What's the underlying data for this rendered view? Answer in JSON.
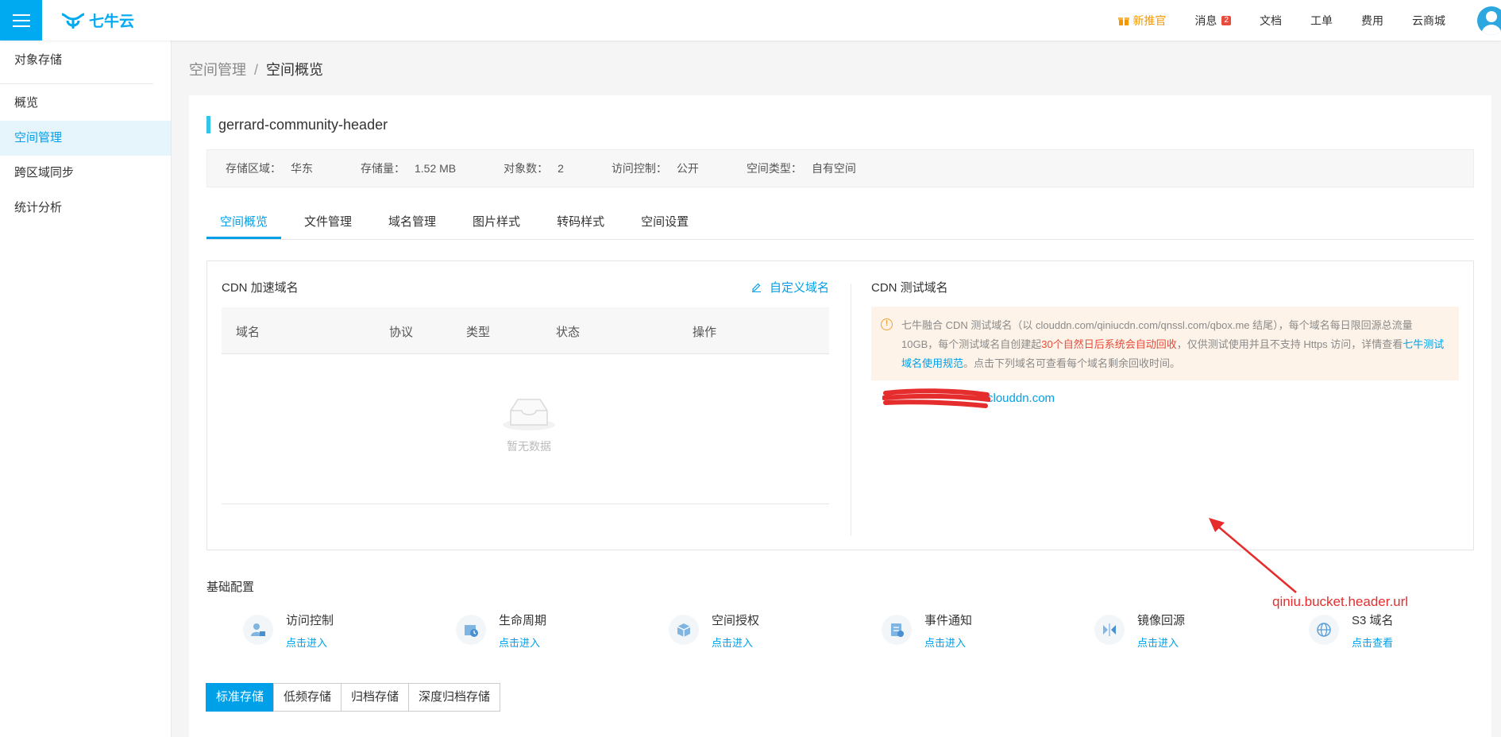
{
  "app": {
    "logo_text": "七牛云"
  },
  "topnav": {
    "promo": "新推官",
    "messages": "消息",
    "messages_count": "2",
    "docs": "文档",
    "tickets": "工单",
    "billing": "费用",
    "market": "云商城"
  },
  "sidebar": {
    "title": "对象存储",
    "items": [
      {
        "label": "概览"
      },
      {
        "label": "空间管理",
        "active": true
      },
      {
        "label": "跨区域同步"
      },
      {
        "label": "统计分析"
      }
    ]
  },
  "breadcrumb": {
    "parent": "空间管理",
    "separator": "/",
    "current": "空间概览"
  },
  "bucket": {
    "name": "gerrard-community-header",
    "region_label": "存储区域：",
    "region": "华东",
    "size_label": "存储量：",
    "size": "1.52 MB",
    "objects_label": "对象数：",
    "objects": "2",
    "access_label": "访问控制：",
    "access": "公开",
    "type_label": "空间类型：",
    "type": "自有空间"
  },
  "tabs": [
    "空间概览",
    "文件管理",
    "域名管理",
    "图片样式",
    "转码样式",
    "空间设置"
  ],
  "cdn": {
    "title": "CDN 加速域名",
    "custom_domain": "自定义域名",
    "columns": [
      "域名",
      "协议",
      "类型",
      "状态",
      "操作"
    ],
    "empty_text": "暂无数据"
  },
  "test_domain": {
    "title": "CDN 测试域名",
    "notice_part1": "七牛融合 CDN 测试域名（以 clouddn.com/qiniucdn.com/qnssl.com/qbox.me 结尾），每个域名每日限回源总流量 10GB，每个测试域名自创建起",
    "notice_red": "30个自然日后系统会自动回收",
    "notice_part2": "，仅供测试使用并且不支持 Https 访问，详情查看",
    "notice_link": "七牛测试域名使用规范",
    "notice_part3": "。点击下列域名可查看每个域名剩余回收时间。",
    "domain_visible": "clouddn.com"
  },
  "annotation": {
    "text": "qiniu.bucket.header.url",
    "color": "#e52d2d"
  },
  "basic_config": {
    "title": "基础配置",
    "features": [
      {
        "name": "访问控制",
        "link": "点击进入",
        "icon": "access-control-icon"
      },
      {
        "name": "生命周期",
        "link": "点击进入",
        "icon": "lifecycle-icon"
      },
      {
        "name": "空间授权",
        "link": "点击进入",
        "icon": "authorization-icon"
      },
      {
        "name": "事件通知",
        "link": "点击进入",
        "icon": "event-notify-icon"
      },
      {
        "name": "镜像回源",
        "link": "点击进入",
        "icon": "mirror-icon"
      },
      {
        "name": "S3 域名",
        "link": "点击查看",
        "icon": "globe-icon"
      }
    ]
  },
  "storage_tabs": [
    "标准存储",
    "低频存储",
    "归档存储",
    "深度归档存储"
  ],
  "colors": {
    "accent": "#00a0e9",
    "brand": "#00aaf0",
    "promo": "#f39800"
  }
}
